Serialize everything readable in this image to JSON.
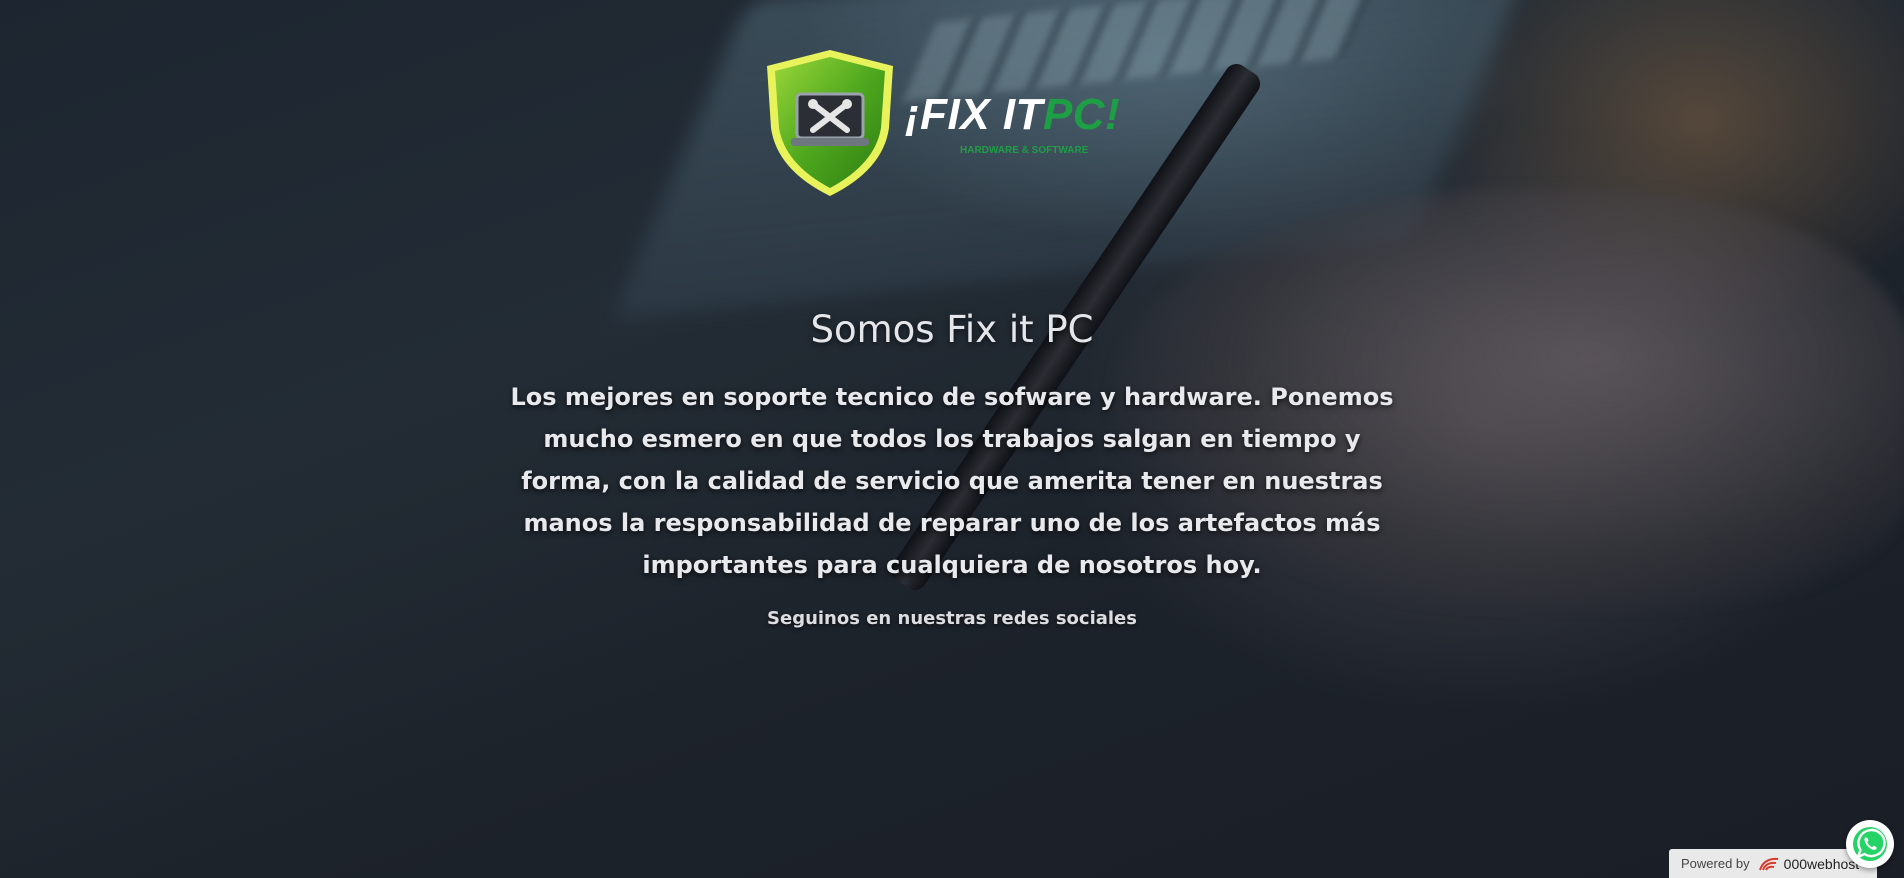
{
  "logo": {
    "wordmark_white": "¡FIX IT",
    "wordmark_green": "PC!",
    "tagline": "HARDWARE & SOFTWARE"
  },
  "hero": {
    "title": "Somos Fix it PC",
    "description": "Los mejores en soporte tecnico de sofware y hardware. Ponemos mucho esmero en que todos los trabajos salgan en tiempo y forma, con la calidad de servicio que amerita tener en nuestras manos la responsabilidad de reparar uno de los artefactos más importantes para cualquiera de nosotros hoy.",
    "social_text": "Seguinos en nuestras redes sociales"
  },
  "footer": {
    "powered_by": "Powered by",
    "host_name": "000webhost"
  },
  "icons": {
    "whatsapp": "whatsapp-icon",
    "shield": "shield-logo-icon",
    "host": "000webhost-logo-icon"
  },
  "colors": {
    "brand_green": "#1e9e45",
    "whatsapp_green": "#25d366",
    "text_light": "#e8e9ec"
  }
}
